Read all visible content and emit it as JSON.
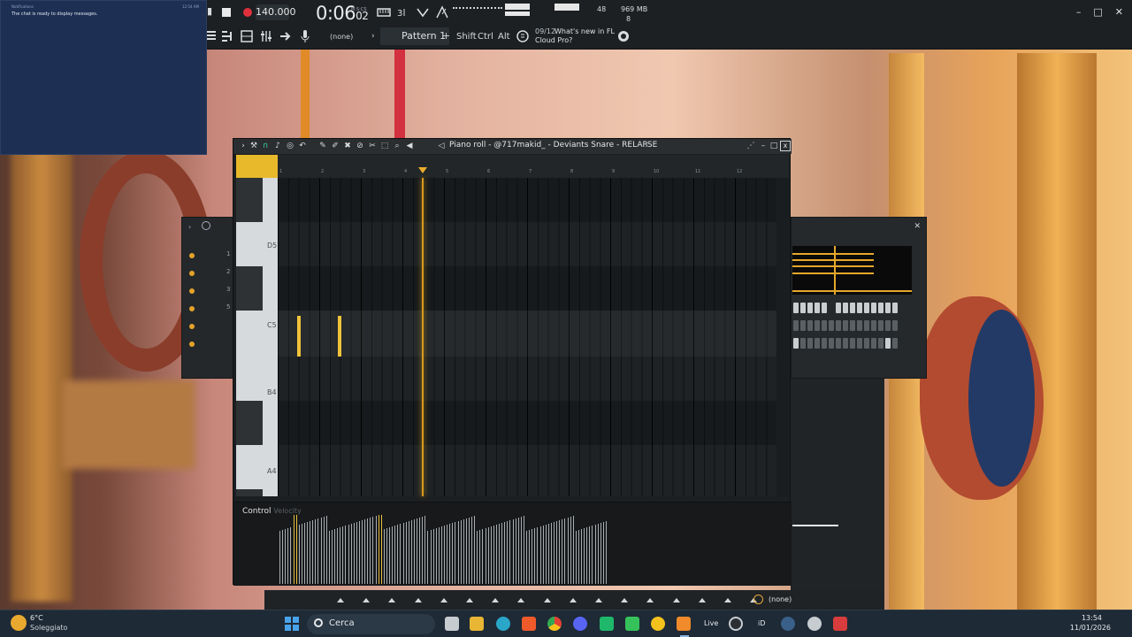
{
  "topbar": {
    "bpm": "140.000",
    "time_main": "0:06",
    "time_small": "02",
    "time_unit": "M:S:CS",
    "cpu_value": "48",
    "memory": "969 MB",
    "polyphony": "8",
    "mixer_target": "(none)",
    "pattern": "Pattern 1",
    "pattern_add": "+",
    "mod_shift": "Shift",
    "mod_ctrl": "Ctrl",
    "mod_alt": "Alt",
    "news_date": "09/12",
    "news_line1": "What's new in FL",
    "news_line2": "Cloud Pro?",
    "window_controls": [
      "–",
      "□",
      "✕"
    ]
  },
  "notification": {
    "header": "Notifications",
    "time": "12:54 AM",
    "message": "The chat is ready to display messages."
  },
  "channel_rack": {
    "rows": [
      "1",
      "2",
      "3",
      "5",
      "",
      "",
      ""
    ]
  },
  "piano_roll": {
    "title": "Piano roll - @717makid_ - Deviants Snare - RELAPSE",
    "title_arrow": "›",
    "close_label": "x",
    "bar_numbers": [
      "1",
      "2",
      "3",
      "4",
      "5",
      "6",
      "7",
      "8",
      "9",
      "10",
      "11",
      "12"
    ],
    "key_labels": [
      "D5",
      "C5",
      "B4",
      "A4"
    ],
    "control_label": "Control",
    "control_param": "Velocity",
    "notes_c5_beats": [
      0.35,
      0.45,
      2.4,
      2.5
    ],
    "accent": "#e8b92a"
  },
  "bottom": {
    "output": "(none)"
  },
  "taskbar": {
    "temperature": "6°C",
    "weather": "Soleggiato",
    "search_label": "Cerca",
    "live": "Live",
    "id": "iD",
    "clock_time": "13:54",
    "clock_date": "11/01/2026",
    "apps": [
      "file-explorer-icon",
      "edge-icon",
      "brave-icon",
      "chrome-icon",
      "discord-icon",
      "app-green-icon",
      "app-green2-icon",
      "norton-icon",
      "fl-studio-icon"
    ]
  }
}
